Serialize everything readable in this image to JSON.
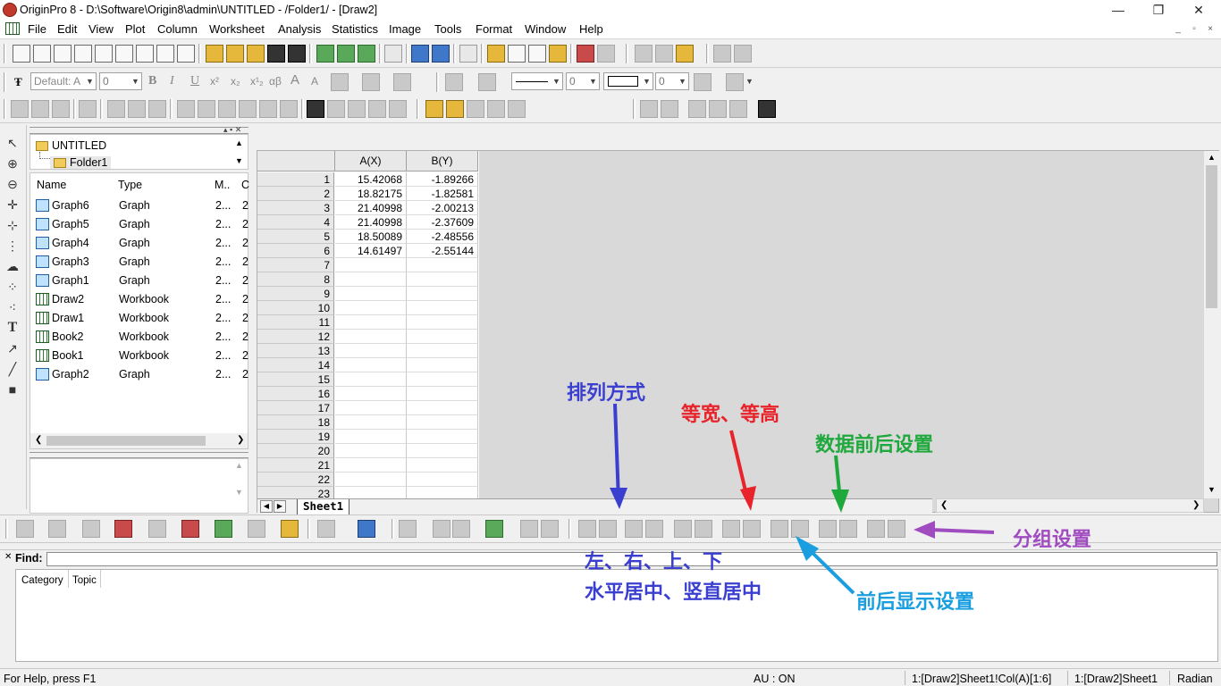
{
  "window": {
    "title": "OriginPro 8 - D:\\Software\\Origin8\\admin\\UNTITLED - /Folder1/ - [Draw2]",
    "controls": {
      "minimize": "—",
      "restore": "❐",
      "close": "✕"
    }
  },
  "menu": [
    "File",
    "Edit",
    "View",
    "Plot",
    "Column",
    "Worksheet",
    "Analysis",
    "Statistics",
    "Image",
    "Tools",
    "Format",
    "Window",
    "Help"
  ],
  "mdi_controls": {
    "minimize": "_",
    "restore": "▫",
    "close": "×"
  },
  "format_toolbar": {
    "font": "Default: A",
    "font_size": "0",
    "bold": "B",
    "italic": "I",
    "underline": "U",
    "superscript": "x²",
    "subscript": "x₂",
    "supsub": "x¹₂",
    "greek": "αβ",
    "larger": "A",
    "smaller": "A",
    "line_width": "0",
    "pattern_width": "0"
  },
  "project_explorer": {
    "tree": {
      "root": "UNTITLED",
      "folder": "Folder1"
    },
    "columns": [
      "Name",
      "Type",
      "M..",
      "C"
    ],
    "items": [
      {
        "name": "Graph6",
        "type": "Graph",
        "m": "2...",
        "c": "2",
        "icon": "graph-icon"
      },
      {
        "name": "Graph5",
        "type": "Graph",
        "m": "2...",
        "c": "2",
        "icon": "graph-icon"
      },
      {
        "name": "Graph4",
        "type": "Graph",
        "m": "2...",
        "c": "2",
        "icon": "graph-icon"
      },
      {
        "name": "Graph3",
        "type": "Graph",
        "m": "2...",
        "c": "2",
        "icon": "graph-icon"
      },
      {
        "name": "Graph1",
        "type": "Graph",
        "m": "2...",
        "c": "2",
        "icon": "graph-icon"
      },
      {
        "name": "Draw2",
        "type": "Workbook",
        "m": "2...",
        "c": "2",
        "icon": "workbook-icon"
      },
      {
        "name": "Draw1",
        "type": "Workbook",
        "m": "2...",
        "c": "2",
        "icon": "workbook-icon"
      },
      {
        "name": "Book2",
        "type": "Workbook",
        "m": "2...",
        "c": "2",
        "icon": "workbook-icon"
      },
      {
        "name": "Book1",
        "type": "Workbook",
        "m": "2...",
        "c": "2",
        "icon": "workbook-icon"
      },
      {
        "name": "Graph2",
        "type": "Graph",
        "m": "2...",
        "c": "2",
        "icon": "graph-icon"
      }
    ]
  },
  "worksheet": {
    "columns": [
      "A(X)",
      "B(Y)"
    ],
    "rows": [
      [
        "1",
        "15.42068",
        "-1.89266"
      ],
      [
        "2",
        "18.82175",
        "-1.82581"
      ],
      [
        "3",
        "21.40998",
        "-2.00213"
      ],
      [
        "4",
        "21.40998",
        "-2.37609"
      ],
      [
        "5",
        "18.50089",
        "-2.48556"
      ],
      [
        "6",
        "14.61497",
        "-2.55144"
      ],
      [
        "7",
        "",
        ""
      ],
      [
        "8",
        "",
        ""
      ],
      [
        "9",
        "",
        ""
      ],
      [
        "10",
        "",
        ""
      ],
      [
        "11",
        "",
        ""
      ],
      [
        "12",
        "",
        ""
      ],
      [
        "13",
        "",
        ""
      ],
      [
        "14",
        "",
        ""
      ],
      [
        "15",
        "",
        ""
      ],
      [
        "16",
        "",
        ""
      ],
      [
        "17",
        "",
        ""
      ],
      [
        "18",
        "",
        ""
      ],
      [
        "19",
        "",
        ""
      ],
      [
        "20",
        "",
        ""
      ],
      [
        "21",
        "",
        ""
      ],
      [
        "22",
        "",
        ""
      ],
      [
        "23",
        "",
        ""
      ]
    ],
    "sheet_tab": "Sheet1"
  },
  "annotations": {
    "arrange": "排列方式",
    "same_size": "等宽、等高",
    "data_order": "数据前后设置",
    "group": "分组设置",
    "align_line1": "左、右、上、下",
    "align_line2": "水平居中、竖直居中",
    "front_back": "前后显示设置",
    "colors": {
      "blue": "#3a3fd0",
      "red": "#e8232a",
      "green": "#1fa83c",
      "purple": "#a04cc0",
      "cyan": "#1a9ee0"
    }
  },
  "find": {
    "label": "Find:",
    "tabs": [
      "Category",
      "Topic"
    ]
  },
  "statusbar": {
    "help": "For Help, press F1",
    "au": "AU : ON",
    "cell": "1:[Draw2]Sheet1!Col(A)[1:6]",
    "sheet": "1:[Draw2]Sheet1",
    "angle": "Radian"
  }
}
